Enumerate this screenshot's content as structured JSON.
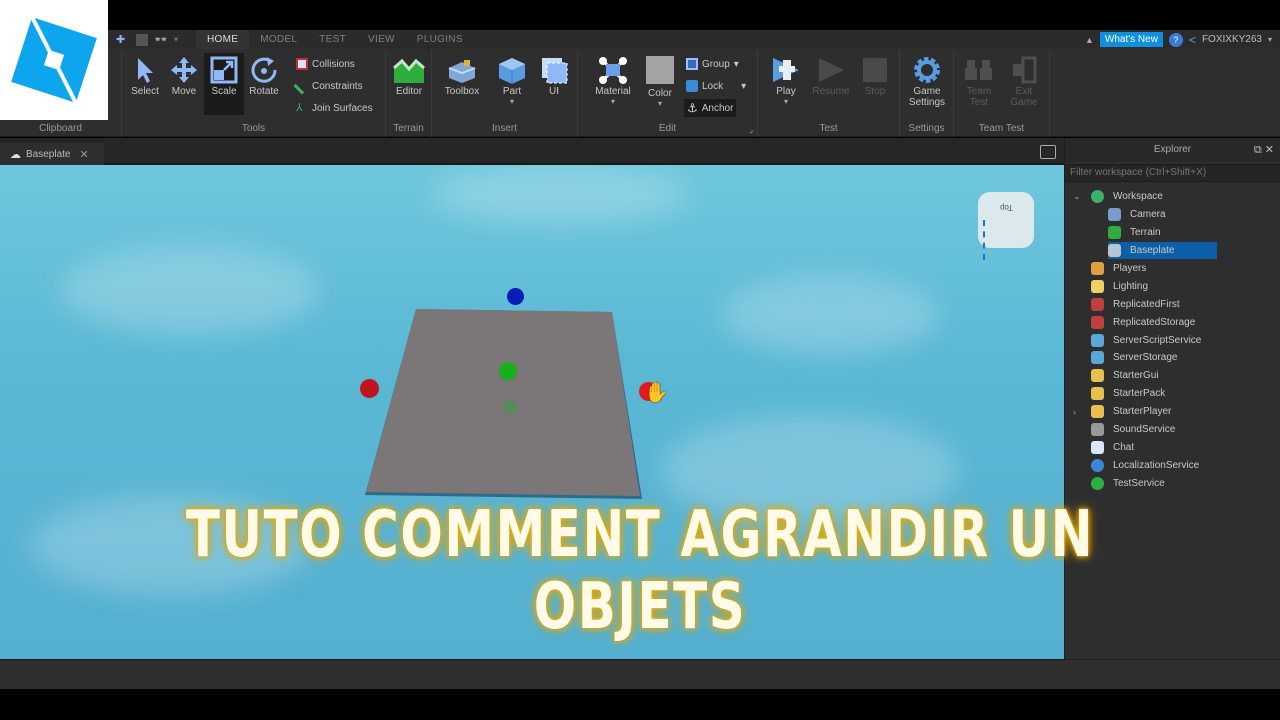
{
  "app": {
    "name": "Roblox Studio",
    "brand_color": "#0e90e0"
  },
  "menubar": {
    "tabs": [
      {
        "label": "HOME",
        "active": true
      },
      {
        "label": "MODEL",
        "active": false
      },
      {
        "label": "TEST",
        "active": false
      },
      {
        "label": "VIEW",
        "active": false
      },
      {
        "label": "PLUGINS",
        "active": false
      }
    ],
    "whats_new": "What's New",
    "help_icon": "question-circle-icon",
    "share_icon": "share-icon",
    "username": "FOXIXKY263",
    "collapse_icon": "chevron-up-icon"
  },
  "ribbon": {
    "groups": {
      "clipboard": "Clipboard",
      "tools": "Tools",
      "terrain": "Terrain",
      "insert": "Insert",
      "edit": "Edit",
      "test": "Test",
      "settings": "Settings",
      "team_test": "Team Test"
    },
    "tools": {
      "select": "Select",
      "move": "Move",
      "scale": "Scale",
      "rotate": "Rotate",
      "collisions": "Collisions",
      "constraints": "Constraints",
      "join_surfaces": "Join Surfaces",
      "editor": "Editor",
      "toolbox": "Toolbox",
      "part": "Part",
      "ui": "UI",
      "material": "Material",
      "color": "Color",
      "group": "Group",
      "lock": "Lock",
      "anchor": "Anchor",
      "play": "Play",
      "resume": "Resume",
      "stop": "Stop",
      "game_settings_1": "Game",
      "game_settings_2": "Settings",
      "team_test_1": "Team",
      "team_test_2": "Test",
      "exit_game_1": "Exit",
      "exit_game_2": "Game",
      "dropdown_glyph": "▾"
    }
  },
  "document": {
    "tab_label": "Baseplate",
    "close_glyph": "✕"
  },
  "viewport": {
    "viewcube_top_label": "Top",
    "handle_colors": {
      "x_axis": "#c0161b",
      "y_axis": "#16b01a",
      "z_axis": "#0a1cb8"
    },
    "part_color": "#7b7779"
  },
  "explorer": {
    "title": "Explorer",
    "filter_placeholder": "Filter workspace (Ctrl+Shift+X)",
    "items": [
      {
        "label": "Workspace",
        "depth": 0,
        "expanded": true,
        "icon": "workspace-globe-icon",
        "color": "#3bb06b"
      },
      {
        "label": "Camera",
        "depth": 1,
        "icon": "camera-icon",
        "color": "#7a9ccc"
      },
      {
        "label": "Terrain",
        "depth": 1,
        "icon": "terrain-icon",
        "color": "#2fae3e"
      },
      {
        "label": "Baseplate",
        "depth": 1,
        "selected": true,
        "icon": "part-icon",
        "color": "#b8c4d4"
      },
      {
        "label": "Players",
        "depth": 0,
        "icon": "players-icon",
        "color": "#e0a040"
      },
      {
        "label": "Lighting",
        "depth": 0,
        "icon": "lightbulb-icon",
        "color": "#f0d060"
      },
      {
        "label": "ReplicatedFirst",
        "depth": 0,
        "icon": "replicated-first-icon",
        "color": "#c04040"
      },
      {
        "label": "ReplicatedStorage",
        "depth": 0,
        "icon": "replicated-storage-icon",
        "color": "#c04040"
      },
      {
        "label": "ServerScriptService",
        "depth": 0,
        "icon": "server-script-service-icon",
        "color": "#5aa8d8"
      },
      {
        "label": "ServerStorage",
        "depth": 0,
        "icon": "server-storage-icon",
        "color": "#5aa8d8"
      },
      {
        "label": "StarterGui",
        "depth": 0,
        "icon": "starter-gui-folder-icon",
        "color": "#e8c050"
      },
      {
        "label": "StarterPack",
        "depth": 0,
        "icon": "starter-pack-folder-icon",
        "color": "#e8c050"
      },
      {
        "label": "StarterPlayer",
        "depth": 0,
        "expandable": true,
        "icon": "starter-player-folder-icon",
        "color": "#e8c050"
      },
      {
        "label": "SoundService",
        "depth": 0,
        "icon": "speaker-icon",
        "color": "#999999"
      },
      {
        "label": "Chat",
        "depth": 0,
        "icon": "chat-bubble-icon",
        "color": "#d8e8f8"
      },
      {
        "label": "LocalizationService",
        "depth": 0,
        "icon": "localization-icon",
        "color": "#3a88d8"
      },
      {
        "label": "TestService",
        "depth": 0,
        "icon": "checkmark-icon",
        "color": "#2bb040"
      }
    ]
  },
  "overlay": {
    "line1": "TUTO COMMENT AGRANDIR UN",
    "line2": "OBJETS"
  }
}
